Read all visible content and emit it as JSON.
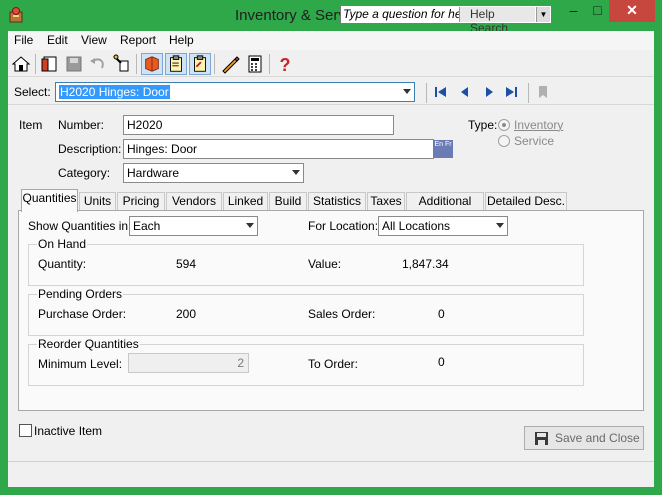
{
  "window": {
    "title": "Inventory & Serv",
    "question_placeholder": "Type a question for help",
    "help_search_label": "Help Search",
    "minimize_symbol": "–",
    "maximize_symbol": "□",
    "close_symbol": "✕"
  },
  "menu": [
    "File",
    "Edit",
    "View",
    "Report",
    "Help"
  ],
  "select": {
    "label": "Select:",
    "value": "H2020  Hinges: Door"
  },
  "item": {
    "section_label": "Item",
    "number_label": "Number:",
    "number_value": "H2020",
    "description_label": "Description:",
    "description_value": "Hinges: Door",
    "lang_button": "En Fr",
    "category_label": "Category:",
    "category_value": "Hardware",
    "type_label": "Type:",
    "type_inventory": "Inventory",
    "type_service": "Service"
  },
  "tabs": [
    "Quantities",
    "Units",
    "Pricing",
    "Vendors",
    "Linked",
    "Build",
    "Statistics",
    "Taxes",
    "Additional Info",
    "Detailed Desc."
  ],
  "quantities": {
    "show_label": "Show Quantities in:",
    "show_value": "Each",
    "location_label": "For Location:",
    "location_value": "All Locations",
    "on_hand_title": "On Hand",
    "quantity_label": "Quantity:",
    "quantity_value": "594",
    "value_label": "Value:",
    "value_value": "1,847.34",
    "pending_title": "Pending Orders",
    "purchase_order_label": "Purchase Order:",
    "purchase_order_value": "200",
    "sales_order_label": "Sales Order:",
    "sales_order_value": "0",
    "reorder_title": "Reorder Quantities",
    "minimum_level_label": "Minimum Level:",
    "minimum_level_value": "2",
    "to_order_label": "To Order:",
    "to_order_value": "0"
  },
  "footer": {
    "inactive_label": "Inactive Item",
    "save_close_label": "Save and Close"
  },
  "colors": {
    "window_frame": "#2fa84a",
    "close_button": "#c7463d",
    "selection": "#3399ff",
    "help_icon": "#d0202a"
  }
}
